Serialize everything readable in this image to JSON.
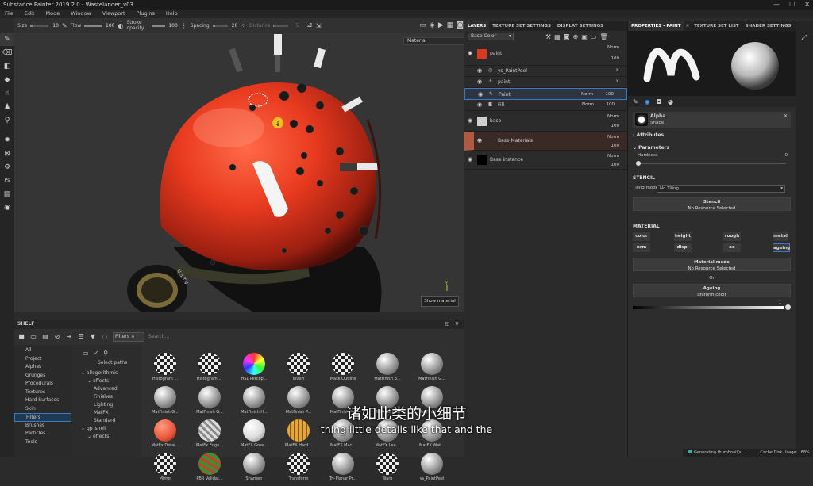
{
  "window": {
    "title": "Substance Painter 2019.2.0 - Wastelander_v03",
    "min": "—",
    "max": "☐",
    "close": "✕"
  },
  "menu": [
    "File",
    "Edit",
    "Mode",
    "Window",
    "Viewport",
    "Plugins",
    "Help"
  ],
  "toolbar": {
    "size_label": "Size",
    "size_value": "10",
    "flow_label": "Flow",
    "flow_value": "100",
    "stroke_label": "Stroke opacity",
    "stroke_value": "100",
    "spacing_label": "Spacing",
    "spacing_value": "20",
    "distance_label": "Distance",
    "distance_value": "5"
  },
  "viewport": {
    "material_mode": "Material",
    "show_material": "Show material",
    "axis_label": "Y"
  },
  "shelf": {
    "title": "SHELF",
    "filter_chip": "Filters",
    "search_placeholder": "Search...",
    "categories": [
      "All",
      "Project",
      "Alphas",
      "Grunges",
      "Procedurals",
      "Textures",
      "Hard Surfaces",
      "Skin",
      "Filters",
      "Brushes",
      "Particles",
      "Tools"
    ],
    "selected_category": "Filters",
    "select_paths": "Select paths",
    "tree": [
      {
        "label": "allegorithmic",
        "indent": 0
      },
      {
        "label": "effects",
        "indent": 1
      },
      {
        "label": "Advanced",
        "indent": 2
      },
      {
        "label": "Finishes",
        "indent": 2
      },
      {
        "label": "Lighting",
        "indent": 2
      },
      {
        "label": "MatFX",
        "indent": 2
      },
      {
        "label": "Standard",
        "indent": 2
      },
      {
        "label": "gp_shelf",
        "indent": 0
      },
      {
        "label": "effects",
        "indent": 1
      }
    ],
    "materials": [
      {
        "label": "Histogram ...",
        "style": "checker"
      },
      {
        "label": "Histogram ...",
        "style": "checker"
      },
      {
        "label": "HSL Percep...",
        "style": "rainbow"
      },
      {
        "label": "Invert",
        "style": "checker"
      },
      {
        "label": "Mask Outline",
        "style": "checker"
      },
      {
        "label": "MatFinish B...",
        "style": "chrome"
      },
      {
        "label": "MatFinish G...",
        "style": "chrome"
      },
      {
        "label": "MatFinish G...",
        "style": "chrome"
      },
      {
        "label": "MatFinish G...",
        "style": "chrome"
      },
      {
        "label": "MatFinish H...",
        "style": "chrome"
      },
      {
        "label": "MatFinish P...",
        "style": "chrome"
      },
      {
        "label": "MatFinish P...",
        "style": "chrome"
      },
      {
        "label": "MatFinish R...",
        "style": "chrome"
      },
      {
        "label": "MatFinish R...",
        "style": "chrome"
      },
      {
        "label": "MatFx Detai...",
        "style": "redcross"
      },
      {
        "label": "MatFx Edge...",
        "style": "stripes"
      },
      {
        "label": "MatFX Gree...",
        "style": "white"
      },
      {
        "label": "MatFX Hard...",
        "style": "gold"
      },
      {
        "label": "MatFX Mac...",
        "style": "chrome"
      },
      {
        "label": "MatFX Lea...",
        "style": "chrome"
      },
      {
        "label": "MatFX Wat...",
        "style": "chrome"
      },
      {
        "label": "Mirror",
        "style": "checker"
      },
      {
        "label": "PBR Validat...",
        "style": "green"
      },
      {
        "label": "Sharpen",
        "style": "chrome"
      },
      {
        "label": "Transform",
        "style": "checker"
      },
      {
        "label": "Tri-Planar Pr...",
        "style": "chrome"
      },
      {
        "label": "Warp",
        "style": "checker"
      },
      {
        "label": "ys_PaintPeel",
        "style": "chrome"
      }
    ]
  },
  "layers": {
    "tabs": [
      "LAYERS",
      "TEXTURE SET SETTINGS",
      "DISPLAY SETTINGS"
    ],
    "channel": "Base Color",
    "rows": [
      {
        "name": "paint",
        "blend": "Norm",
        "opacity": "100",
        "type": "group",
        "color": "#d83a20"
      },
      {
        "name": "ys_PaintPeel",
        "type": "sub-filter"
      },
      {
        "name": "paint",
        "type": "sub-anchor"
      },
      {
        "name": "Paint",
        "blend": "Norm",
        "opacity": "100",
        "type": "sub-paint"
      },
      {
        "name": "Fill",
        "blend": "Norm",
        "opacity": "100",
        "type": "sub-fill"
      },
      {
        "name": "base",
        "blend": "Norm",
        "opacity": "100",
        "type": "layer",
        "color": "#cfcfcf"
      },
      {
        "name": "Base Materials",
        "blend": "Norm",
        "opacity": "100",
        "type": "folder"
      },
      {
        "name": "Base instance",
        "blend": "Norm",
        "opacity": "100",
        "type": "instance",
        "color": "#000000"
      }
    ]
  },
  "properties": {
    "tabs": [
      "PROPERTIES - PAINT",
      "TEXTURE SET LIST",
      "SHADER SETTINGS"
    ],
    "alpha_label": "Alpha",
    "alpha_sub": "Shape",
    "attributes": "Attributes",
    "parameters": "Parameters",
    "hardness_label": "Hardness",
    "hardness_value": "0",
    "stencil_title": "STENCIL",
    "tiling_label": "Tiling mode",
    "tiling_value": "No Tiling",
    "stencil_btn": "Stencil",
    "stencil_sub": "No Resource Selected",
    "material_title": "MATERIAL",
    "channels": [
      "color",
      "height",
      "rough",
      "metal",
      "nrm",
      "displ",
      "ao",
      "ageing"
    ],
    "material_mode": "Material mode",
    "material_mode_sub": "No Resource Selected",
    "or": "Or",
    "ageing": "Ageing",
    "ageing_sub": "uniform color",
    "ageing_value": "1"
  },
  "status": {
    "text": "Generating thumbnail(s) ...",
    "cache": "Cache Disk Usage:",
    "cache_value": "68%"
  },
  "subtitles": {
    "cn": "诸如此类的小细节",
    "en": "thing little details like that and the"
  }
}
